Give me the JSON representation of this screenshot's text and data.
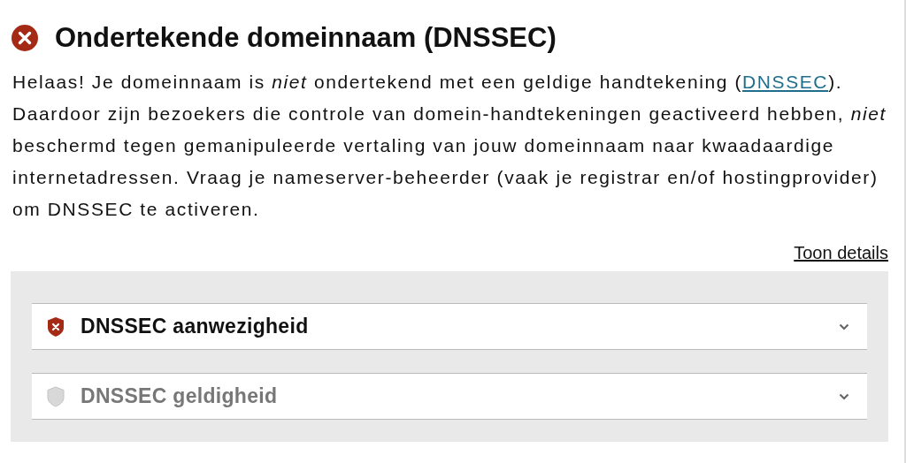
{
  "heading": {
    "title": "Ondertekende domeinnaam (DNSSEC)",
    "kind": "fail"
  },
  "intro": {
    "before": "Helaas! Je domeinnaam is *niet* ondertekend met een geldige handtekening (",
    "link": "DNSSEC",
    "after": "). Daardoor zijn bezoekers die controle van domein-handtekeningen geactiveerd hebben, *niet* beschermd tegen gemanipuleerde vertaling van jouw domeinnaam naar kwaadaardige internetadressen. Vraag je nameserver-beheerder (vaak je registrar en/of hostingprovider) om DNSSEC te activeren."
  },
  "details_link": "Toon details",
  "checks": [
    {
      "label": "DNSSEC aanwezigheid",
      "kind": "fail",
      "expanded": false
    },
    {
      "label": "DNSSEC geldigheid",
      "kind": "neutral",
      "expanded": false
    }
  ]
}
